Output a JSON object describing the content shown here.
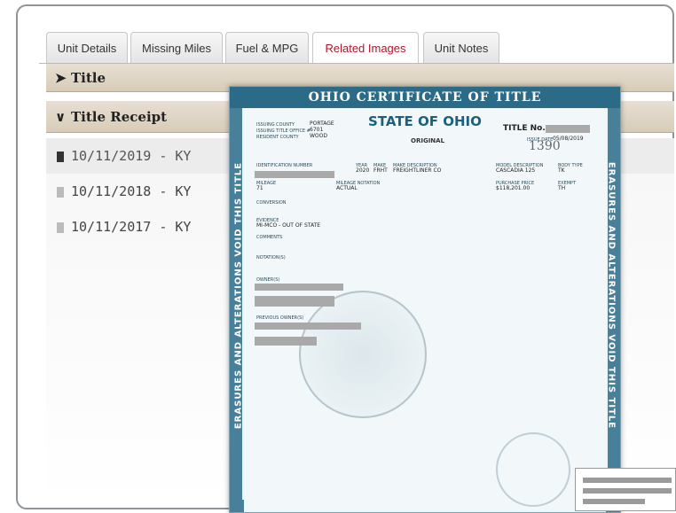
{
  "tabs": [
    {
      "label": "Unit Details",
      "active": false
    },
    {
      "label": "Missing Miles",
      "active": false
    },
    {
      "label": "Fuel & MPG",
      "active": false
    },
    {
      "label": "Related Images",
      "active": true
    },
    {
      "label": "Unit Notes",
      "active": false
    }
  ],
  "accordion": {
    "title_label": "Title",
    "receipt_label": "Title Receipt"
  },
  "receipts": [
    {
      "label": "10/11/2019 - KY",
      "selected": true
    },
    {
      "label": "10/11/2018 - KY",
      "selected": false
    },
    {
      "label": "10/11/2017 - KY",
      "selected": false
    }
  ],
  "certificate": {
    "header": "OHIO CERTIFICATE OF TITLE",
    "state": "STATE OF OHIO",
    "original": "ORIGINAL",
    "title_no_label": "TITLE No.",
    "issue_date_label": "ISSUE DATE",
    "issue_date": "05/08/2019",
    "handwritten": "1390",
    "issuing_county_label": "ISSUING COUNTY",
    "issuing_county": "PORTAGE",
    "issuing_office_label": "ISSUING TITLE OFFICE #",
    "issuing_office": "6701",
    "resident_county_label": "RESIDENT COUNTY",
    "resident_county": "WOOD",
    "id_number_label": "IDENTIFICATION NUMBER",
    "year_label": "YEAR",
    "year": "2020",
    "make_label": "MAKE",
    "make": "FRHT",
    "make_desc_label": "MAKE DESCRIPTION",
    "make_desc": "FREIGHTLINER CO",
    "model_desc_label": "MODEL DESCRIPTION",
    "model_desc": "CASCADIA 125",
    "body_type_label": "BODY TYPE",
    "body_type": "TK",
    "mileage_label": "MILEAGE",
    "mileage": "71",
    "mileage_notation_label": "MILEAGE NOTATION",
    "mileage_notation": "ACTUAL",
    "purchase_price_label": "PURCHASE PRICE",
    "purchase_price": "$118,201.00",
    "exempt_label": "EXEMPT",
    "exempt": "TH",
    "conversion_label": "CONVERSION",
    "evidence_label": "EVIDENCE",
    "evidence": "MI-MCO - OUT OF STATE",
    "comments_label": "COMMENTS",
    "notations_label": "NOTATION(S)",
    "owners_label": "OWNER(S)",
    "previous_owners_label": "PREVIOUS OWNER(S)",
    "left_border_text": "ERASURES AND ALTERATIONS VOID THIS TITLE",
    "right_border_text": "ERASURES AND ALTERATIONS VOID THIS TITLE"
  }
}
